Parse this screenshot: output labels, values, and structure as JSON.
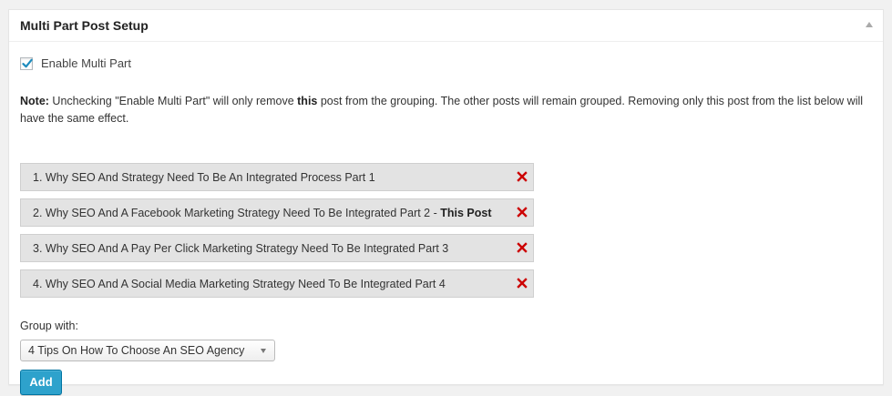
{
  "metabox": {
    "title": "Multi Part Post Setup"
  },
  "enable": {
    "label": "Enable Multi Part",
    "checked": true
  },
  "note": {
    "prefix": "Note:",
    "text_before": " Unchecking \"Enable Multi Part\" will only remove ",
    "emphasis": "this",
    "text_after": " post from the grouping. The other posts will remain grouped. Removing only this post from the list below will have the same effect."
  },
  "parts": [
    {
      "label": "1. Why SEO And Strategy Need To Be An Integrated Process Part 1",
      "suffix": ""
    },
    {
      "label": "2. Why SEO And A Facebook Marketing Strategy Need To Be Integrated Part 2 - ",
      "suffix": "This Post"
    },
    {
      "label": "3. Why SEO And A Pay Per Click Marketing Strategy Need To Be Integrated Part 3",
      "suffix": ""
    },
    {
      "label": "4. Why SEO And A Social Media Marketing Strategy Need To Be Integrated Part 4",
      "suffix": ""
    }
  ],
  "group": {
    "label": "Group with:",
    "selected": "4 Tips On How To Choose An SEO Agency"
  },
  "add_button": {
    "label": "Add"
  },
  "colors": {
    "remove_icon": "#cc0000",
    "checkmark": "#1e8cbe",
    "button": "#2ea2cc"
  }
}
